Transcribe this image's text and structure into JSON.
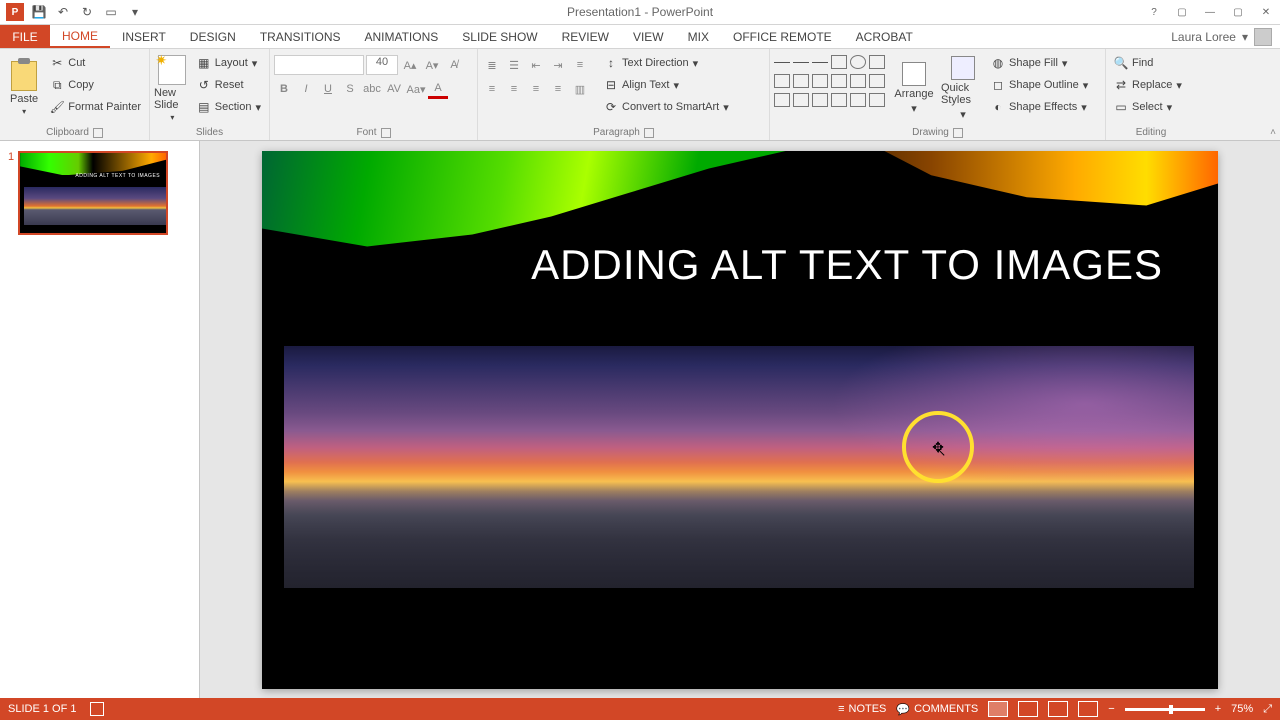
{
  "title": "Presentation1 - PowerPoint",
  "user": "Laura Loree",
  "tabs": [
    "FILE",
    "HOME",
    "INSERT",
    "DESIGN",
    "TRANSITIONS",
    "ANIMATIONS",
    "SLIDE SHOW",
    "REVIEW",
    "VIEW",
    "MIX",
    "OFFICE REMOTE",
    "ACROBAT"
  ],
  "active_tab": "HOME",
  "clipboard": {
    "paste": "Paste",
    "cut": "Cut",
    "copy": "Copy",
    "format_painter": "Format Painter",
    "label": "Clipboard"
  },
  "slides_group": {
    "new_slide": "New Slide",
    "layout": "Layout",
    "reset": "Reset",
    "section": "Section",
    "label": "Slides"
  },
  "font_group": {
    "size": "40",
    "label": "Font"
  },
  "paragraph_group": {
    "text_direction": "Text Direction",
    "align_text": "Align Text",
    "smartart": "Convert to SmartArt",
    "label": "Paragraph"
  },
  "drawing_group": {
    "arrange": "Arrange",
    "quick_styles": "Quick Styles",
    "shape_fill": "Shape Fill",
    "shape_outline": "Shape Outline",
    "shape_effects": "Shape Effects",
    "label": "Drawing"
  },
  "editing_group": {
    "find": "Find",
    "replace": "Replace",
    "select": "Select",
    "label": "Editing"
  },
  "slide": {
    "title": "ADDING ALT TEXT TO IMAGES"
  },
  "thumbnail": {
    "number": "1"
  },
  "status": {
    "slide": "SLIDE 1 OF 1",
    "notes": "NOTES",
    "comments": "COMMENTS",
    "zoom": "75%"
  }
}
